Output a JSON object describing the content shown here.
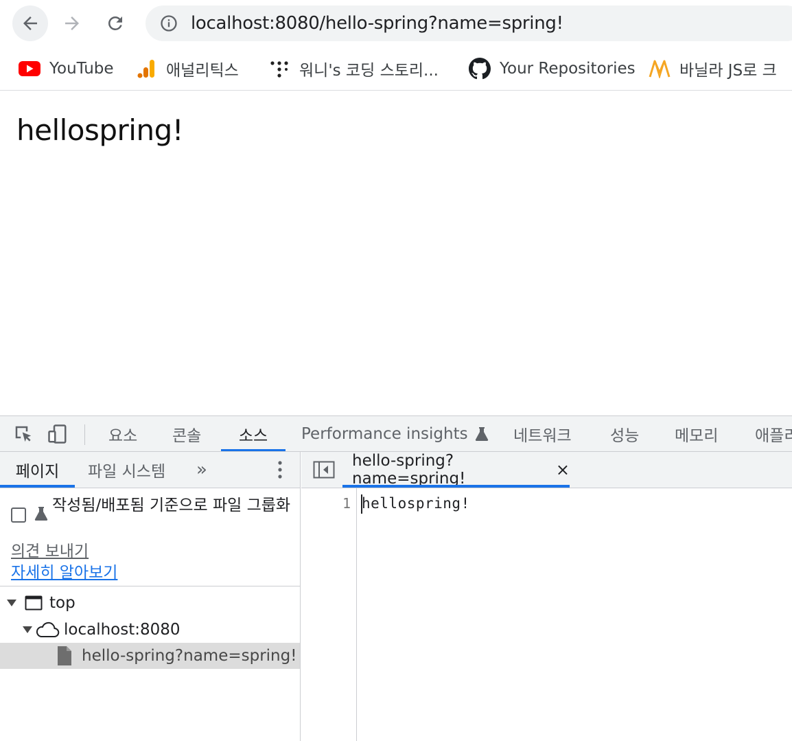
{
  "browser": {
    "url": "localhost:8080/hello-spring?name=spring!",
    "bookmarks": [
      {
        "label": "YouTube",
        "icon": "youtube-icon"
      },
      {
        "label": "애널리틱스",
        "icon": "analytics-icon"
      },
      {
        "label": "워니's 코딩 스토리...",
        "icon": "dots-logo-icon"
      },
      {
        "label": "Your Repositories",
        "icon": "github-icon"
      },
      {
        "label": "바닐라 JS로 크",
        "icon": "nomad-logo-icon"
      }
    ]
  },
  "page": {
    "content": "hellospring!"
  },
  "devtools": {
    "tabs": [
      "요소",
      "콘솔",
      "소스",
      "Performance insights",
      "네트워크",
      "성능",
      "메모리",
      "애플리"
    ],
    "active_tab": "소스",
    "sources": {
      "nav_tabs": [
        "페이지",
        "파일 시스템"
      ],
      "more": "»",
      "group_label": "작성됨/배포됨 기준으로 파일 그룹화",
      "feedback": "의견 보내기",
      "learn_more": "자세히 알아보기",
      "tree": {
        "top": "top",
        "origin": "localhost:8080",
        "file": "hello-spring?name=spring!"
      },
      "editor": {
        "tab_name": "hello-spring?name=spring!",
        "close": "×",
        "line_number": "1",
        "line_content": "hellospring!"
      }
    }
  },
  "colors": {
    "accent": "#1a73e8",
    "youtube_red": "#ff0000",
    "analytics_orange": "#f9ab00",
    "nomad_orange": "#f5a623"
  }
}
